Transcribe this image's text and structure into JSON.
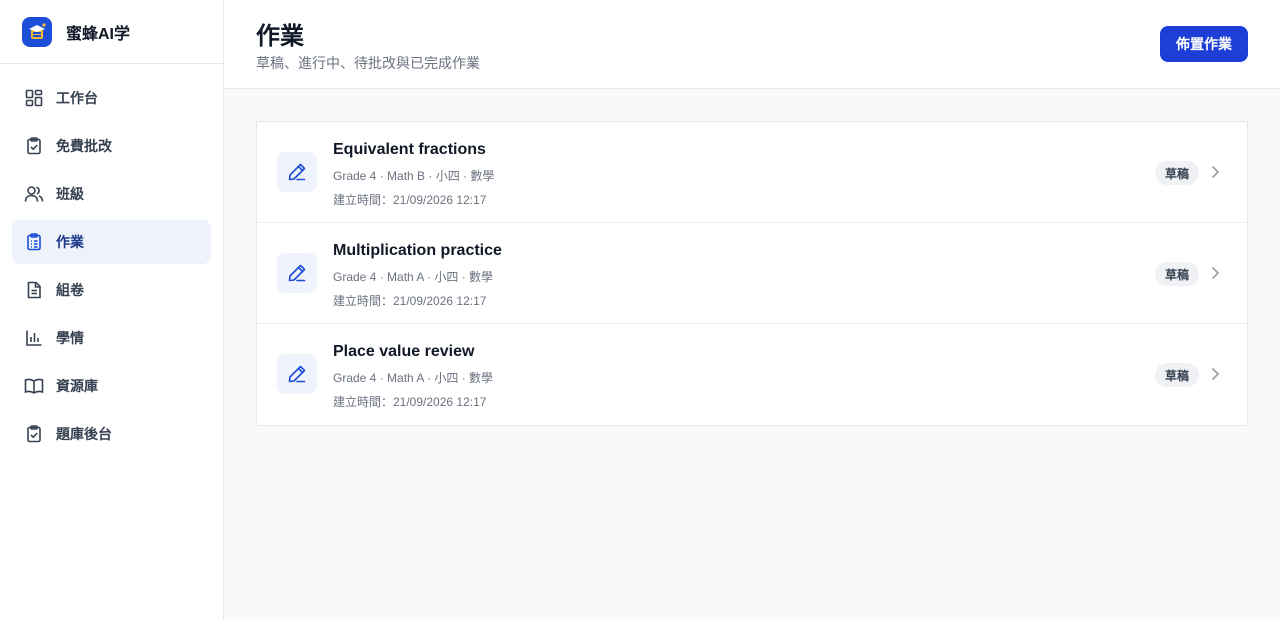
{
  "brand": {
    "name": "蜜蜂AI学",
    "icon": "graduation-cap-icon",
    "color": "#1d4ed8"
  },
  "sidebar": {
    "items": [
      {
        "label": "工作台",
        "icon": "dashboard-grid-icon",
        "active": false
      },
      {
        "label": "免費批改",
        "icon": "clipboard-check-icon",
        "active": false
      },
      {
        "label": "班級",
        "icon": "users-icon",
        "active": false
      },
      {
        "label": "作業",
        "icon": "clipboard-list-icon",
        "active": true
      },
      {
        "label": "組卷",
        "icon": "document-icon",
        "active": false
      },
      {
        "label": "學情",
        "icon": "bar-chart-icon",
        "active": false
      },
      {
        "label": "資源庫",
        "icon": "book-open-icon",
        "active": false
      },
      {
        "label": "題庫後台",
        "icon": "clipboard-check-icon",
        "active": false
      }
    ]
  },
  "header": {
    "title": "作業",
    "subtitle": "草稿、進行中、待批改與已完成作業",
    "action_label": "佈置作業",
    "action_color": "#1d3fd8"
  },
  "assignments": [
    {
      "title": "Equivalent fractions",
      "meta": "Grade 4 · Math B · 小四 · 數學",
      "created": "建立時間：21/09/2026 12:17",
      "status": "草稿",
      "icon": "pencil-icon"
    },
    {
      "title": "Multiplication practice",
      "meta": "Grade 4 · Math A · 小四 · 數學",
      "created": "建立時間：21/09/2026 12:17",
      "status": "草稿",
      "icon": "pencil-icon"
    },
    {
      "title": "Place value review",
      "meta": "Grade 4 · Math A · 小四 · 數學",
      "created": "建立時間：21/09/2026 12:17",
      "status": "草稿",
      "icon": "pencil-icon"
    }
  ]
}
